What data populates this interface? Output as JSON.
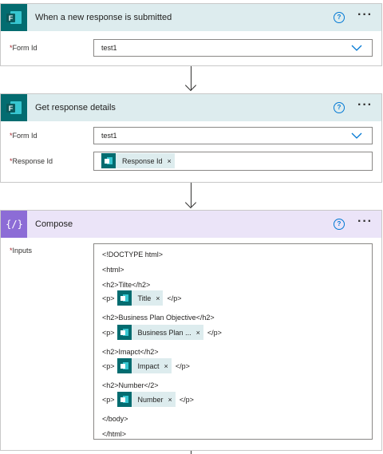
{
  "trigger": {
    "title": "When a new response is submitted",
    "form_id_label": "Form Id",
    "form_id_value": "test1"
  },
  "details": {
    "title": "Get response details",
    "form_id_label": "Form Id",
    "form_id_value": "test1",
    "response_id_label": "Response Id",
    "response_token": "Response Id"
  },
  "compose": {
    "title": "Compose",
    "inputs_label": "Inputs",
    "lines": [
      {
        "pre": "<!DOCTYPE html>"
      },
      {
        "pre": "<html>"
      },
      {
        "pre": "<h2>Tilte</h2>"
      },
      {
        "pre": "<p>",
        "token": "Title",
        "post": "</p>"
      },
      {
        "pre": "<h2>Business Plan Objective</h2>"
      },
      {
        "pre": "<p>",
        "token": "Business Plan ...",
        "post": "</p>"
      },
      {
        "pre": "<h2>Imapct</h2>"
      },
      {
        "pre": "<p>",
        "token": "Impact",
        "post": "</p>"
      },
      {
        "pre": "<h2>Number</2>"
      },
      {
        "pre": "<p>",
        "token": "Number",
        "post": "</p>"
      },
      {
        "pre": "</body>"
      },
      {
        "pre": "</html>"
      }
    ]
  },
  "common": {
    "required_mark": "*",
    "help_glyph": "?",
    "more_glyph": "···",
    "token_remove": "×"
  },
  "colors": {
    "forms_header": "#ddecee",
    "forms_icon": "#036c70",
    "compose_header": "#ebe4f8",
    "compose_icon": "#8c6cd6",
    "link": "#0078d4"
  },
  "icons": {
    "forms": "forms-app-icon",
    "compose": "compose-curly-braces-icon",
    "help": "help-circle-icon",
    "more": "more-options-icon",
    "dropdown": "chevron-down-icon",
    "arrow": "arrow-down-icon"
  }
}
